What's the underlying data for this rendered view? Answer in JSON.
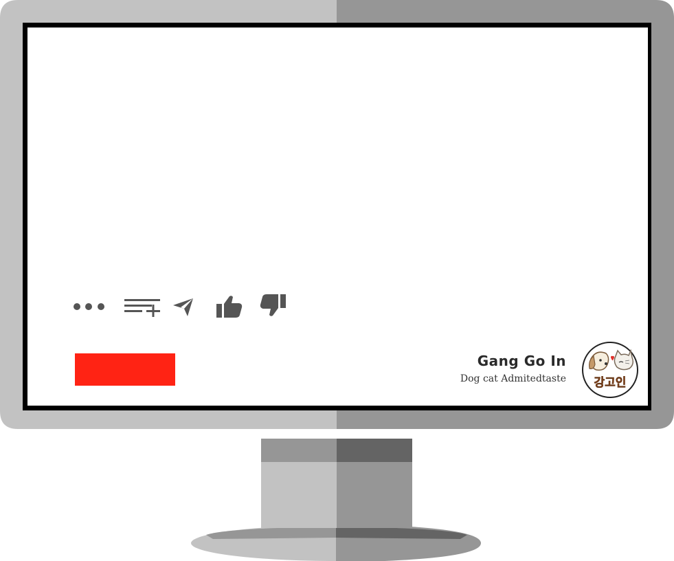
{
  "channel": {
    "name": "Gang Go In",
    "tagline": "Dog cat Admitedtaste",
    "logo_text": "강고인"
  },
  "toolbar": {
    "buttons": [
      {
        "id": "more",
        "icon": "more-dots-icon"
      },
      {
        "id": "save-to-playlist",
        "icon": "playlist-add-icon"
      },
      {
        "id": "share",
        "icon": "send-icon"
      },
      {
        "id": "like",
        "icon": "thumbs-up-icon"
      },
      {
        "id": "dislike",
        "icon": "thumbs-down-icon"
      }
    ]
  },
  "colors": {
    "subscribe": "#ff2314",
    "icon": "#555555",
    "bezel_light": "#c2c2c2",
    "bezel_dark": "#969696",
    "screen_border": "#000000",
    "logo_text": "#f06a1e"
  }
}
